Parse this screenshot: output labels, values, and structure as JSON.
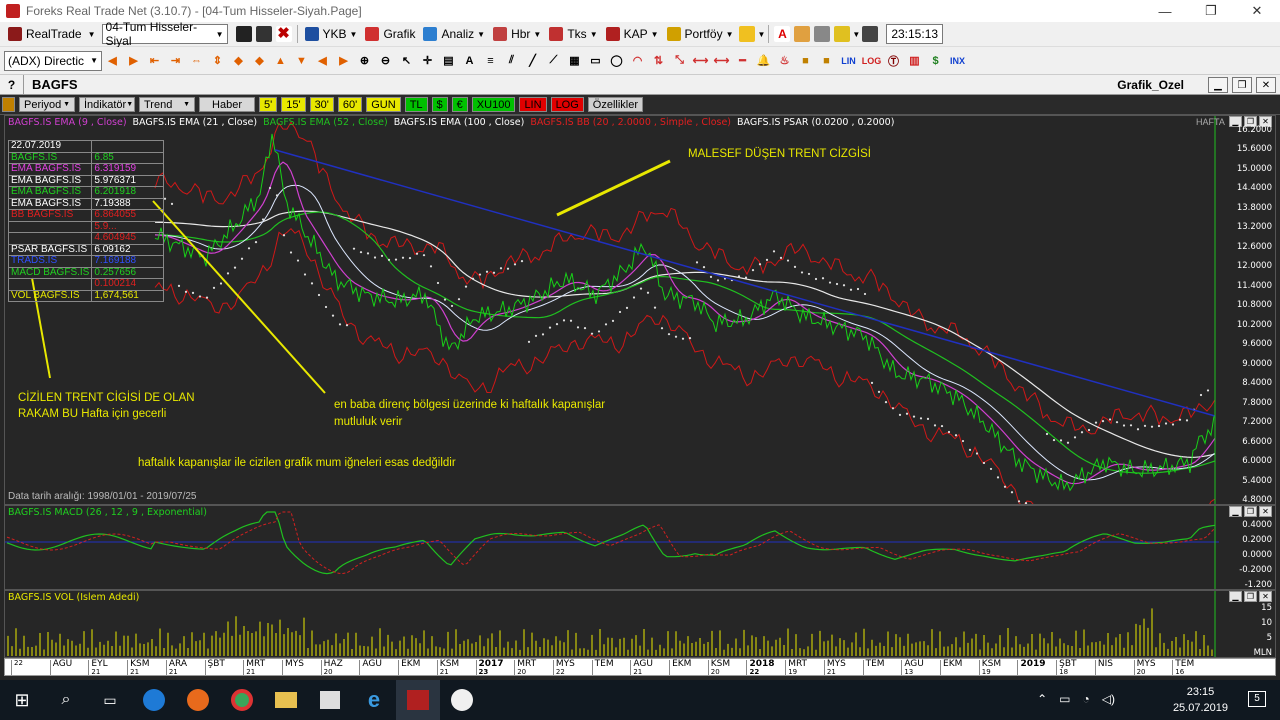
{
  "window": {
    "title": "Foreks Real Trade Net (3.10.7) - [04-Tum Hisseler-Siyah.Page]",
    "controls": [
      "—",
      "❐",
      "✕"
    ]
  },
  "toolbar1": {
    "realtrade_label": "RealTrade",
    "page_select": "04-Tum Hisseler-Siyal",
    "ykb_label": "YKB",
    "grafik_label": "Grafik",
    "analiz_label": "Analiz",
    "hbr_label": "Hbr",
    "tks_label": "Tks",
    "kap_label": "KAP",
    "portfoy_label": "Portföy",
    "time": "23:15:13"
  },
  "toolbar2": {
    "indicator_select": "(ADX) Directic",
    "lin_label": "LIN",
    "log_label": "LOG",
    "inx_label": "INX"
  },
  "mdi": {
    "question": "?",
    "symbol": "BAGFS",
    "graph_name": "Grafik_Ozel"
  },
  "chart_toolbar": {
    "periyod": "Periyod",
    "indikator": "İndikatör",
    "trend": "Trend",
    "haber": "Haber",
    "periods": [
      "5'",
      "15'",
      "30'",
      "60'",
      "GUN",
      "TL",
      "$",
      "€",
      "XU100",
      "LIN",
      "LOG"
    ],
    "ozellikler": "Özellikler"
  },
  "price_panel": {
    "legend": [
      {
        "text": "BAGFS.IS EMA (9 , Close)",
        "color": "#d040d0"
      },
      {
        "text": "BAGFS.IS EMA (21 , Close)",
        "color": "#ffffff"
      },
      {
        "text": "BAGFS.IS EMA (52 , Close)",
        "color": "#20c020"
      },
      {
        "text": "BAGFS.IS EMA (100 , Close)",
        "color": "#ffffff"
      },
      {
        "text": "BAGFS.IS BB (20 , 2.0000 , Simple , Close)",
        "color": "#e02020"
      },
      {
        "text": "BAGFS.IS PSAR (0.0200 , 0.2000)",
        "color": "#ffffff"
      }
    ],
    "period_tag": "HAFTA",
    "date_range": "Data tarih aralığı: 1998/01/01 - 2019/07/25",
    "table": [
      {
        "label": "22.07.2019",
        "value": "",
        "color": "#ffffff"
      },
      {
        "label": "BAGFS.IS",
        "value": "6.85",
        "color": "#20d020"
      },
      {
        "label": "EMA BAGFS.IS",
        "value": "6.319159",
        "color": "#e040e0"
      },
      {
        "label": "EMA BAGFS.IS",
        "value": "5.976371",
        "color": "#ffffff"
      },
      {
        "label": "EMA BAGFS.IS",
        "value": "6.201918",
        "color": "#20d020"
      },
      {
        "label": "EMA BAGFS.IS",
        "value": "7.19388",
        "color": "#ffffff"
      },
      {
        "label": "BB BAGFS.IS",
        "value": "6.864055",
        "color": "#e02020"
      },
      {
        "label": "",
        "value": "5.9...",
        "color": "#e02020"
      },
      {
        "label": "",
        "value": "4.604945",
        "color": "#e02020"
      },
      {
        "label": "PSAR BAGFS.IS",
        "value": "6.09162",
        "color": "#ffffff"
      },
      {
        "label": "TRADS.IS",
        "value": "7.169188",
        "color": "#3050ff"
      },
      {
        "label": "MACD BAGFS.IS",
        "value": "0.257656",
        "color": "#20d020"
      },
      {
        "label": "",
        "value": "0.100214",
        "color": "#e02020"
      },
      {
        "label": "VOL BAGFS.IS",
        "value": "1,674,561",
        "color": "#e8e800"
      }
    ],
    "y_ticks": [
      "16.2000",
      "15.6000",
      "15.0000",
      "14.4000",
      "13.8000",
      "13.2000",
      "12.6000",
      "12.0000",
      "11.4000",
      "10.8000",
      "10.2000",
      "9.6000",
      "9.0000",
      "8.4000",
      "7.8000",
      "7.2000",
      "6.6000",
      "6.0000",
      "5.4000",
      "4.8000"
    ]
  },
  "annotations": {
    "trend_title": "MALESEF  DÜŞEN TRENT CİZGİSİ",
    "left_note_1": "CİZİLEN TRENT CİGİSİ DE OLAN",
    "left_note_2": "RAKAM BU Hafta için gecerli",
    "mid_note_1": "en baba direnç bölgesi  üzerinde ki haftalık kapanışlar",
    "mid_note_2": "mutluluk verir",
    "bottom_note": "haftalık kapanışlar ile cizilen grafik mum iğneleri esas dedğildir"
  },
  "macd_panel": {
    "legend": "BAGFS.IS MACD (26 , 12 , 9 , Exponential)",
    "y_ticks": [
      "0.4000",
      "0.2000",
      "0.0000",
      "-0.2000",
      "-1.200"
    ]
  },
  "vol_panel": {
    "legend": "BAGFS.IS VOL (Islem Adedi)",
    "y_ticks": [
      "15",
      "10",
      "5",
      "MLN"
    ]
  },
  "x_axis": [
    {
      "m": "",
      "d": "22"
    },
    {
      "m": "AGU",
      "d": ""
    },
    {
      "m": "EYL",
      "d": "21"
    },
    {
      "m": "KSM",
      "d": "21"
    },
    {
      "m": "ARA",
      "d": "21"
    },
    {
      "m": "ŞBT",
      "d": ""
    },
    {
      "m": "MRT",
      "d": "21"
    },
    {
      "m": "MYS",
      "d": ""
    },
    {
      "m": "HAZ",
      "d": "20"
    },
    {
      "m": "AGU",
      "d": ""
    },
    {
      "m": "EKM",
      "d": ""
    },
    {
      "m": "KSM",
      "d": "21"
    },
    {
      "m": "2017",
      "d": "23"
    },
    {
      "m": "MRT",
      "d": "20"
    },
    {
      "m": "MYS",
      "d": "22"
    },
    {
      "m": "TEM",
      "d": ""
    },
    {
      "m": "AGU",
      "d": "21"
    },
    {
      "m": "EKM",
      "d": ""
    },
    {
      "m": "KSM",
      "d": "20"
    },
    {
      "m": "2018",
      "d": "22"
    },
    {
      "m": "MRT",
      "d": "19"
    },
    {
      "m": "MYS",
      "d": "21"
    },
    {
      "m": "TEM",
      "d": ""
    },
    {
      "m": "AGU",
      "d": "13"
    },
    {
      "m": "EKM",
      "d": ""
    },
    {
      "m": "KSM",
      "d": "19"
    },
    {
      "m": "2019",
      "d": ""
    },
    {
      "m": "ŞBT",
      "d": "18"
    },
    {
      "m": "NIS",
      "d": ""
    },
    {
      "m": "MYS",
      "d": "20"
    },
    {
      "m": "TEM",
      "d": "16"
    }
  ],
  "taskbar": {
    "time": "23:15",
    "date": "25.07.2019",
    "notif": "5"
  }
}
